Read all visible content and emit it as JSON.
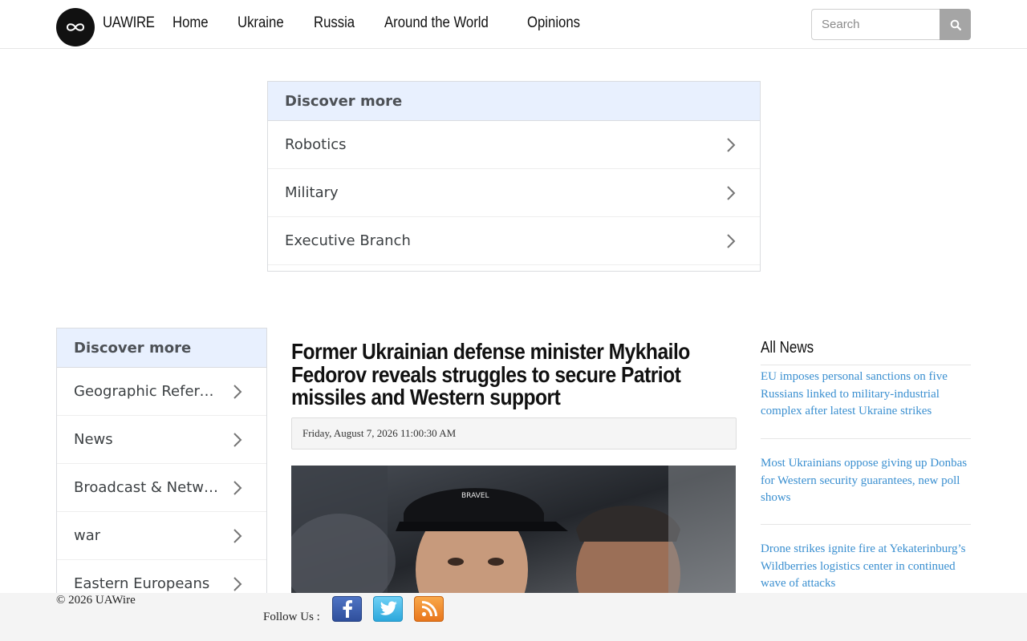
{
  "header": {
    "brand": "UAWIRE",
    "nav": [
      "Home",
      "Ukraine",
      "Russia",
      "Around the World",
      "Opinions"
    ],
    "search_placeholder": "Search"
  },
  "discover_top": {
    "title": "Discover more",
    "items": [
      "Robotics",
      "Military",
      "Executive Branch"
    ]
  },
  "discover_side": {
    "title": "Discover more",
    "items": [
      "Geographic Reference",
      "News",
      "Broadcast & Network",
      "war",
      "Eastern Europeans"
    ]
  },
  "article": {
    "title": "Former Ukrainian defense minister Mykhailo Fedorov reveals struggles to secure Patriot missiles and Western support",
    "date": "Friday, August 7, 2026 11:00:30 AM",
    "cap_text": "BRAVEL"
  },
  "all_news": {
    "title": "All News",
    "items": [
      "EU imposes personal sanctions on five Russians linked to military-industrial complex after latest Ukraine strikes",
      "Most Ukrainians oppose giving up Donbas for Western security guarantees, new poll shows",
      "Drone strikes ignite fire at Yekaterinburg’s Wildberries logistics center in continued wave of attacks"
    ]
  },
  "footer": {
    "copyright": "© 2026 UAWire",
    "follow_label": "Follow Us :"
  },
  "colors": {
    "link": "#3a8fd0",
    "discover_header_bg": "#e8f0fe",
    "search_button": "#a5a5a5"
  }
}
